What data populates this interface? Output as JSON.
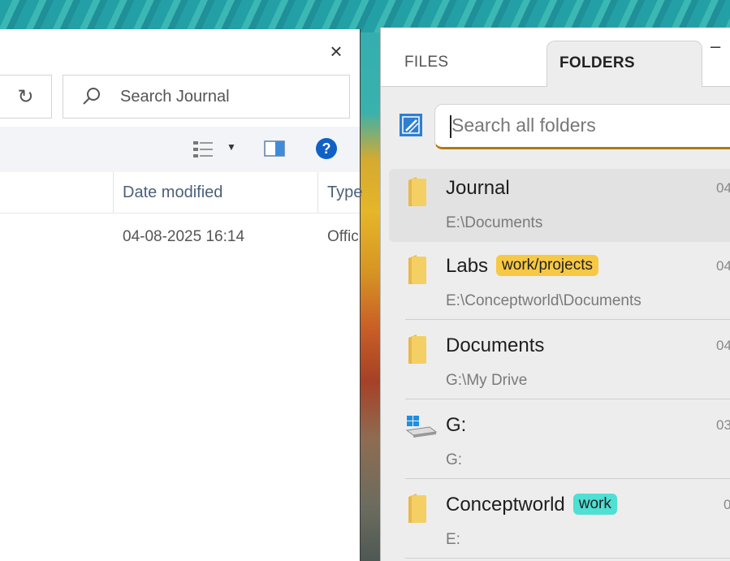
{
  "explorer": {
    "search_placeholder": "Search Journal",
    "columns": {
      "date": "Date modified",
      "type": "Type"
    },
    "row": {
      "date": "04-08-2025 16:14",
      "type": "Offic"
    }
  },
  "panel": {
    "tabs": [
      {
        "label": "FILES"
      },
      {
        "label": "FOLDERS"
      }
    ],
    "minimize_label": "–",
    "search_placeholder": "Search all folders",
    "items": [
      {
        "name": "Journal",
        "path": "E:\\Documents",
        "date": "04",
        "tag": ""
      },
      {
        "name": "Labs",
        "path": "E:\\Conceptworld\\Documents",
        "date": "04",
        "tag": "work/projects"
      },
      {
        "name": "Documents",
        "path": "G:\\My Drive",
        "date": "04",
        "tag": ""
      },
      {
        "name": "G:",
        "path": "G:",
        "date": "03",
        "tag": ""
      },
      {
        "name": "Conceptworld",
        "path": "E:",
        "date": "0",
        "tag": "work"
      }
    ],
    "colors": {
      "selection_accent": "#a87c22",
      "tag_yellow": "#f7c843",
      "tag_teal": "#4fdfd3",
      "folder": "#f4cf63"
    }
  }
}
